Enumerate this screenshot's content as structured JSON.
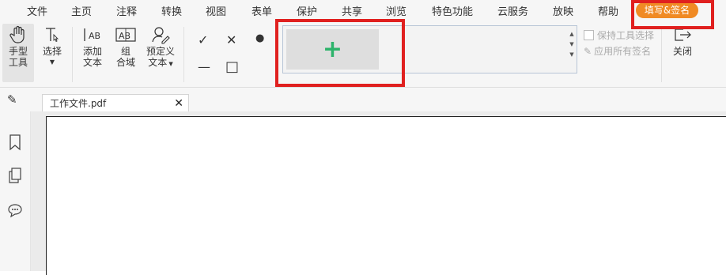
{
  "menu": {
    "items": [
      "文件",
      "主页",
      "注释",
      "转换",
      "视图",
      "表单",
      "保护",
      "共享",
      "浏览",
      "特色功能",
      "云服务",
      "放映",
      "帮助"
    ],
    "active": "填写&签名",
    "active_color": "#f08a24"
  },
  "toolbar": {
    "hand_label_1": "手型",
    "hand_label_2": "工具",
    "select_label": "选择",
    "add_text_label_1": "添加",
    "add_text_label_2": "文本",
    "combo_label_1": "组",
    "combo_label_2": "合域",
    "preset_label_1": "预定义",
    "preset_label_2": "文本",
    "check_icon": "✓",
    "cross_icon": "✕",
    "dot_icon": "●",
    "line_icon": "—",
    "square_icon": "□",
    "add_signature_icon": "+",
    "keep_tool_label": "保持工具选择",
    "apply_all_label": "应用所有签名",
    "close_label": "关闭"
  },
  "tabs": {
    "doc_name": "工作文件.pdf",
    "close_icon": "✕"
  },
  "colors": {
    "highlight_frame": "#e0201f",
    "add_icon": "#2db36b"
  }
}
